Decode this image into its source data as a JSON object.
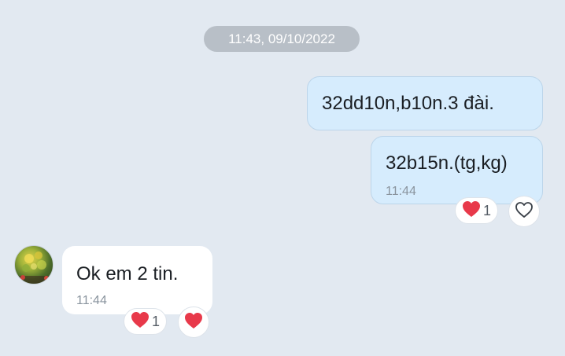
{
  "date_divider": "11:43, 09/10/2022",
  "messages": [
    {
      "text": "32dd10n,b10n.3 đài."
    },
    {
      "text": "32b15n.(tg,kg)",
      "time": "11:44",
      "reaction_count": "1"
    },
    {
      "text": "Ok em 2 tin.",
      "time": "11:44",
      "reaction_count": "1"
    }
  ],
  "icons": {
    "heart": "heart-icon",
    "heart_outline": "heart-outline-icon"
  },
  "colors": {
    "background": "#e2e9f1",
    "outgoing_bubble": "#d6ecfd",
    "incoming_bubble": "#ffffff",
    "heart": "#e8394a"
  }
}
